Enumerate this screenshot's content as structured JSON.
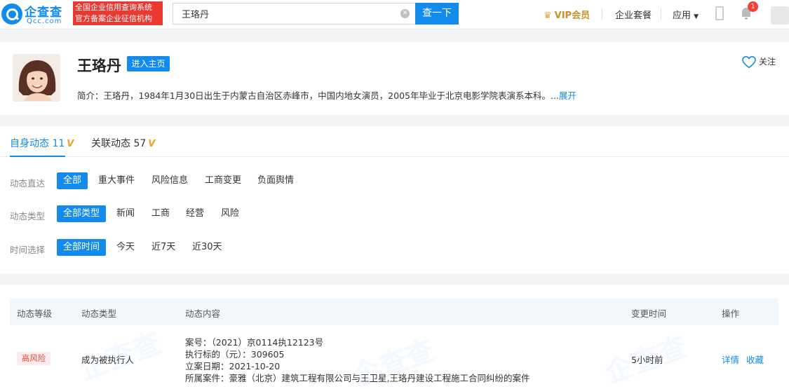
{
  "header": {
    "logo_cn": "企查查",
    "logo_en": "Qcc.com",
    "badge_line1": "全国企业信用查询系统",
    "badge_line2": "官方备案企业征信机构",
    "search_value": "王珞丹",
    "search_button": "查一下",
    "vip_label": "VIP会员",
    "nav_enterprise": "企业套餐",
    "nav_apps": "应用",
    "notification_count": "1"
  },
  "profile": {
    "name": "王珞丹",
    "enter_button": "进入主页",
    "follow_label": "关注",
    "intro": "简介：王珞丹，1984年1月30日出生于内蒙古自治区赤峰市，中国内地女演员，2005年毕业于北京电影学院表演系本科。...",
    "intro_more": "展开"
  },
  "tabs": [
    {
      "label": "自身动态 11",
      "active": true
    },
    {
      "label": "关联动态 57",
      "active": false
    }
  ],
  "filters": {
    "direct": {
      "label": "动态直达",
      "options": [
        "全部",
        "重大事件",
        "风险信息",
        "工商变更",
        "负面舆情"
      ]
    },
    "type": {
      "label": "动态类型",
      "options": [
        "全部类型",
        "新闻",
        "工商",
        "经营",
        "风险"
      ]
    },
    "time": {
      "label": "时间选择",
      "options": [
        "全部时间",
        "今天",
        "近7天",
        "近30天"
      ]
    }
  },
  "table": {
    "headers": [
      "动态等级",
      "动态类型",
      "动态内容",
      "变更时间",
      "操作"
    ],
    "rows": [
      {
        "level": "高风险",
        "type": "成为被执行人",
        "content": [
          "案号：（2021）京0114执12123号",
          "执行标的（元）：309605",
          "立案日期：2021-10-20",
          "所属案件：豪雅（北京）建筑工程有限公司与王卫星,王珞丹建设工程施工合同纠纷的案件"
        ],
        "time": "5小时前",
        "action_detail": "详情",
        "action_collect": "收藏"
      }
    ]
  },
  "colors": {
    "brand": "#128bed",
    "risk": "#e8483d",
    "vip": "#c8932b"
  }
}
